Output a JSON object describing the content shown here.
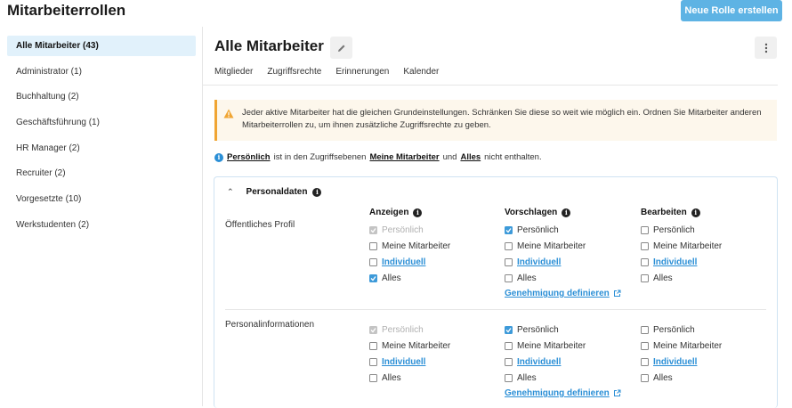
{
  "header": {
    "title": "Mitarbeiterrollen",
    "new_role_label": "Neue Rolle erstellen"
  },
  "sidebar": {
    "items": [
      {
        "label": "Alle Mitarbeiter (43)",
        "active": true
      },
      {
        "label": "Administrator (1)"
      },
      {
        "label": "Buchhaltung (2)"
      },
      {
        "label": "Geschäftsführung (1)"
      },
      {
        "label": "HR Manager (2)"
      },
      {
        "label": "Recruiter (2)"
      },
      {
        "label": "Vorgesetzte (10)"
      },
      {
        "label": "Werkstudenten (2)"
      }
    ]
  },
  "main": {
    "title": "Alle Mitarbeiter",
    "tabs": [
      "Mitglieder",
      "Zugriffsrechte",
      "Erinnerungen",
      "Kalender"
    ],
    "active_tab": "Zugriffsrechte",
    "warning": "Jeder aktive Mitarbeiter hat die gleichen Grundeinstellungen. Schränken Sie diese so weit wie möglich ein. Ordnen Sie Mitarbeiter anderen Mitarbeiterrollen zu, um ihnen zusätzliche Zugriffsrechte zu geben.",
    "info": {
      "term1": "Persönlich",
      "text1": "ist in den Zugriffsebenen",
      "term2": "Meine Mitarbeiter",
      "text2": "und",
      "term3": "Alles",
      "text3": "nicht enthalten."
    },
    "section": {
      "title": "Personaldaten",
      "columns": [
        "Anzeigen",
        "Vorschlagen",
        "Bearbeiten"
      ],
      "options": [
        "Persönlich",
        "Meine Mitarbeiter",
        "Individuell",
        "Alles"
      ],
      "approve_label": "Genehmigung definieren",
      "rows": [
        {
          "label": "Öffentliches Profil"
        },
        {
          "label": "Personalinformationen"
        }
      ]
    }
  },
  "colors": {
    "accent": "#2b8fd6",
    "button": "#5eb3e4",
    "warning": "#f0a533",
    "active_bg": "#e1f1fb"
  },
  "icons": [
    "pencil-icon",
    "kebab-icon",
    "warning-icon",
    "info-icon",
    "chevron-up-icon",
    "external-link-icon",
    "checkmark-icon"
  ]
}
